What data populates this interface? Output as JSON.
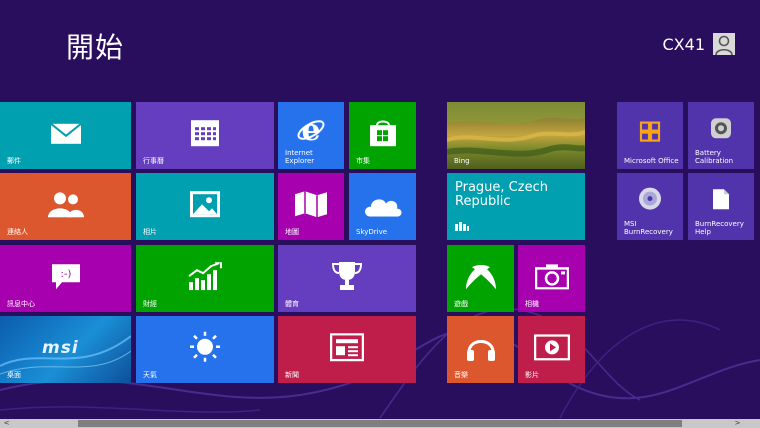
{
  "header": {
    "title": "開始",
    "user_name": "CX41"
  },
  "tiles": {
    "mail": {
      "label": "郵件"
    },
    "calendar": {
      "label": "行事曆"
    },
    "ie": {
      "label": "Internet\nExplorer"
    },
    "store": {
      "label": "市集"
    },
    "bing": {
      "label": "Bing"
    },
    "msoffice": {
      "label": "Microsoft Office"
    },
    "battery": {
      "label": "Battery\nCalibration"
    },
    "people": {
      "label": "連絡人"
    },
    "photos": {
      "label": "相片"
    },
    "maps": {
      "label": "地圖"
    },
    "skydrive": {
      "label": "SkyDrive"
    },
    "weather_city": {
      "label": "Prague, Czech\nRepublic"
    },
    "msi_burn": {
      "label": "MSI\nBurnRecovery"
    },
    "burn_help": {
      "label": "BurnRecovery\nHelp"
    },
    "messaging": {
      "label": "訊息中心"
    },
    "finance": {
      "label": "財經"
    },
    "sports": {
      "label": "體育"
    },
    "games": {
      "label": "遊戲"
    },
    "camera": {
      "label": "相機"
    },
    "desktop": {
      "label": "桌面",
      "logo_text": "msi"
    },
    "weather": {
      "label": "天氣"
    },
    "news": {
      "label": "新聞"
    },
    "music": {
      "label": "音樂"
    },
    "video": {
      "label": "影片"
    }
  },
  "scrollbar": {
    "left_arrow": "<",
    "right_arrow": ">",
    "position_fraction": 0.1
  },
  "colors": {
    "background": "#2a0e5e",
    "teal": "#00a0b1",
    "purple": "#643ebf",
    "blue": "#2672ec",
    "green": "#00a300",
    "orange": "#dc572e",
    "magenta": "#a700ae",
    "crimson": "#bf1e4b",
    "violet": "#5133ab"
  }
}
